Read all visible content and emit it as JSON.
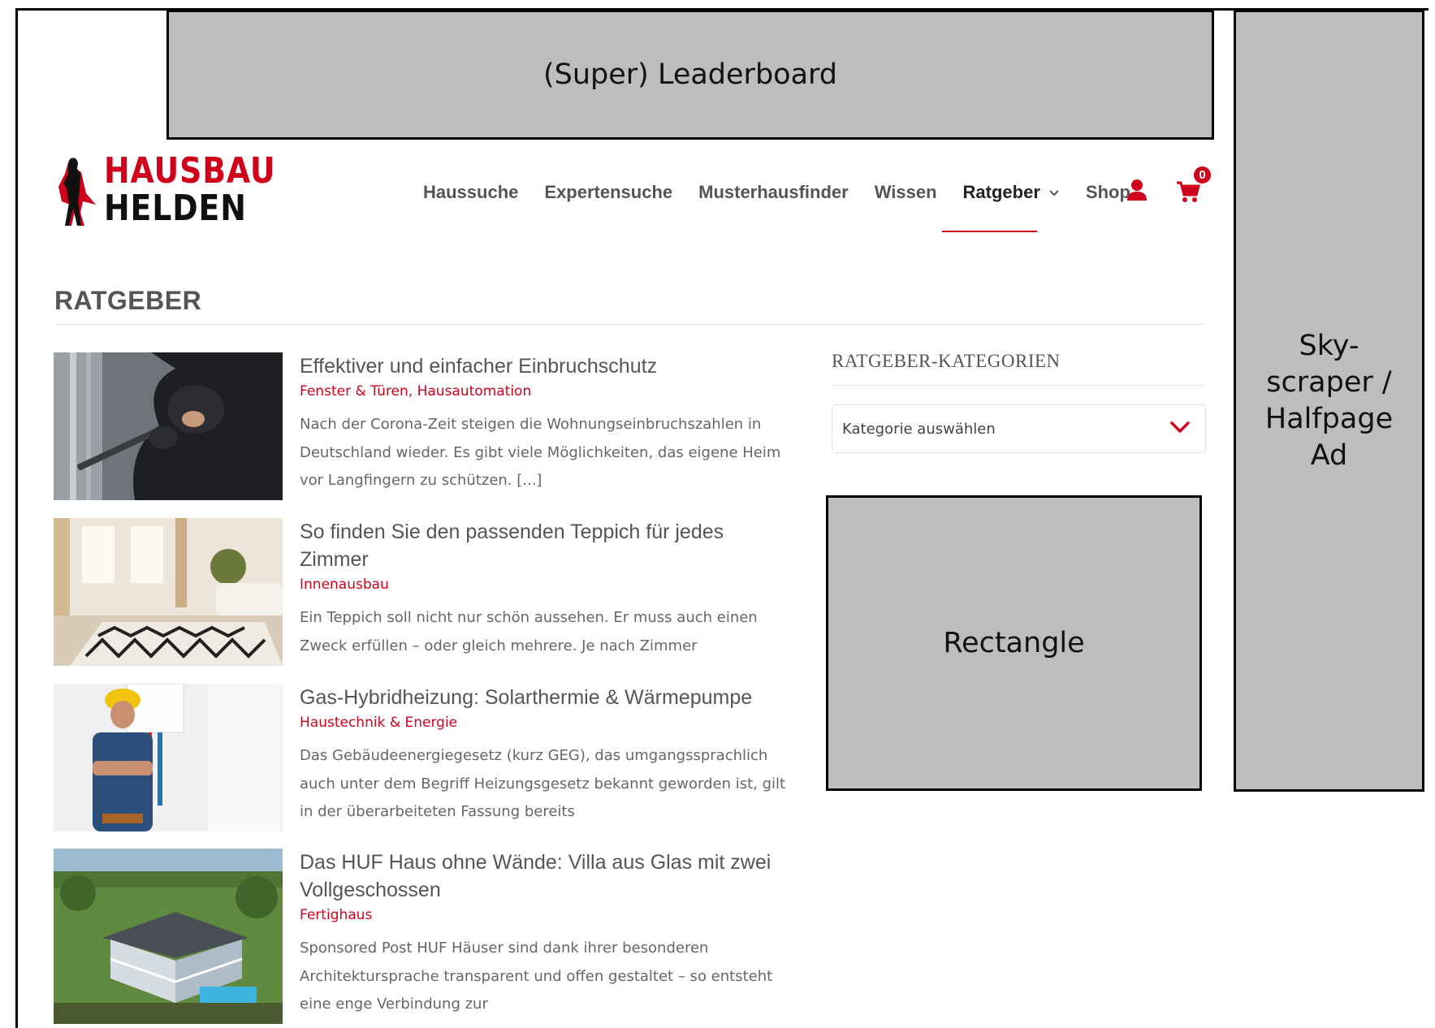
{
  "ads": {
    "leaderboard": "(Super) Leaderboard",
    "skyscraper_lines": [
      "Sky-",
      "scraper /",
      "Halfpage",
      "Ad"
    ],
    "rectangle": "Rectangle"
  },
  "brand": {
    "line1": "HAUSBAU",
    "line2": "HELDEN",
    "accent_color": "#d0021b"
  },
  "nav": {
    "items": [
      {
        "label": "Haussuche"
      },
      {
        "label": "Expertensuche"
      },
      {
        "label": "Musterhausfinder"
      },
      {
        "label": "Wissen"
      },
      {
        "label": "Ratgeber",
        "active": true,
        "dropdown": true
      },
      {
        "label": "Shop"
      }
    ],
    "cart_count": "0",
    "icons": [
      "user-icon",
      "cart-icon",
      "chevron-down-icon"
    ]
  },
  "page": {
    "title": "RATGEBER"
  },
  "articles": [
    {
      "title": "Effektiver und einfacher Einbruchschutz",
      "categories": "Fenster & Türen, Hausautomation",
      "excerpt": "Nach der Corona-Zeit steigen die Wohnungseinbruchszahlen in Deutschland wieder. Es gibt viele Möglichkeiten, das eigene Heim vor Langfingern zu schützen. [...]"
    },
    {
      "title": "So finden Sie den passenden Teppich für jedes Zimmer",
      "categories": "Innenausbau",
      "excerpt": "Ein Teppich soll nicht nur schön aussehen. Er muss auch einen Zweck erfüllen – oder gleich mehrere. Je nach Zimmer"
    },
    {
      "title": "Gas-Hybridheizung: Solarthermie & Wärmepumpe",
      "categories": "Haustechnik & Energie",
      "excerpt": "Das Gebäudeenergiegesetz (kurz GEG), das umgangssprachlich auch unter dem Begriff Heizungsgesetz bekannt geworden ist, gilt in der überarbeiteten Fassung bereits"
    },
    {
      "title": "Das HUF Haus ohne Wände: Villa aus Glas mit zwei Vollgeschossen",
      "categories": "Fertighaus",
      "excerpt": "Sponsored Post HUF Häuser sind dank ihrer besonderen Architektursprache transparent und offen gestaltet – so entsteht eine enge Verbindung zur"
    }
  ],
  "sidebar": {
    "title": "RATGEBER-KATEGORIEN",
    "select_value": "Kategorie auswählen"
  }
}
